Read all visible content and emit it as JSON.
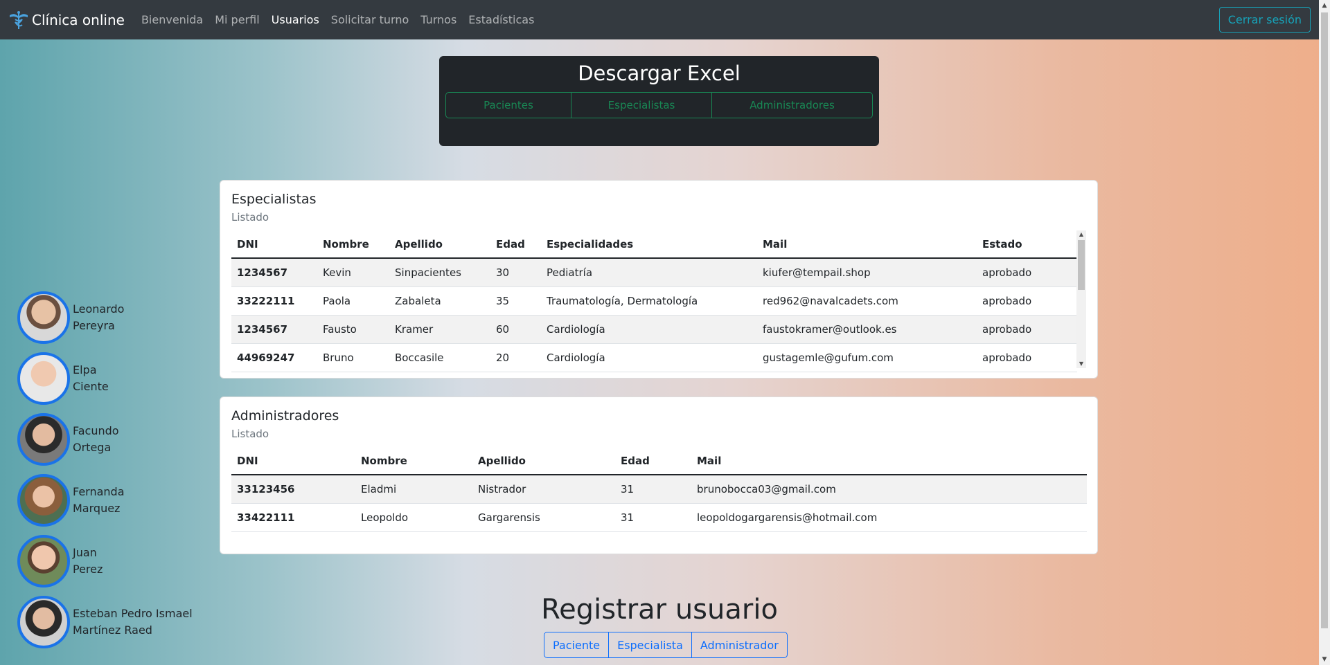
{
  "navbar": {
    "brand": "Clínica online",
    "links": [
      "Bienvenida",
      "Mi perfil",
      "Usuarios",
      "Solicitar turno",
      "Turnos",
      "Estadísticas"
    ],
    "active": "Usuarios",
    "logout": "Cerrar sesión"
  },
  "excel": {
    "title": "Descargar Excel",
    "buttons": [
      "Pacientes",
      "Especialistas",
      "Administradores"
    ]
  },
  "especialistas": {
    "title": "Especialistas",
    "subtitle": "Listado",
    "headers": [
      "DNI",
      "Nombre",
      "Apellido",
      "Edad",
      "Especialidades",
      "Mail",
      "Estado"
    ],
    "rows": [
      [
        "1234567",
        "Kevin",
        "Sinpacientes",
        "30",
        "Pediatría",
        "kiufer@tempail.shop",
        "aprobado"
      ],
      [
        "33222111",
        "Paola",
        "Zabaleta",
        "35",
        "Traumatología, Dermatología",
        "red962@navalcadets.com",
        "aprobado"
      ],
      [
        "1234567",
        "Fausto",
        "Kramer",
        "60",
        "Cardiología",
        "faustokramer@outlook.es",
        "aprobado"
      ],
      [
        "44969247",
        "Bruno",
        "Boccasile",
        "20",
        "Cardiología",
        "gustagemle@gufum.com",
        "aprobado"
      ]
    ]
  },
  "administradores": {
    "title": "Administradores",
    "subtitle": "Listado",
    "headers": [
      "DNI",
      "Nombre",
      "Apellido",
      "Edad",
      "Mail"
    ],
    "rows": [
      [
        "33123456",
        "Eladmi",
        "Nistrador",
        "31",
        "brunobocca03@gmail.com"
      ],
      [
        "33422111",
        "Leopoldo",
        "Gargarensis",
        "31",
        "leopoldogargarensis@hotmail.com"
      ]
    ]
  },
  "quick_users": [
    {
      "first": "Leonardo",
      "last": "Pereyra"
    },
    {
      "first": "Elpa",
      "last": "Ciente"
    },
    {
      "first": "Facundo",
      "last": "Ortega"
    },
    {
      "first": "Fernanda",
      "last": "Marquez"
    },
    {
      "first": "Juan",
      "last": "Perez"
    },
    {
      "first": "Esteban Pedro Ismael",
      "last": "Martínez Raed"
    }
  ],
  "register": {
    "title": "Registrar usuario",
    "buttons": [
      "Paciente",
      "Especialista",
      "Administrador"
    ]
  },
  "colors": {
    "navbar_bg": "#343a40",
    "success": "#198754",
    "primary": "#0d6efd",
    "info": "#17a2b8"
  }
}
